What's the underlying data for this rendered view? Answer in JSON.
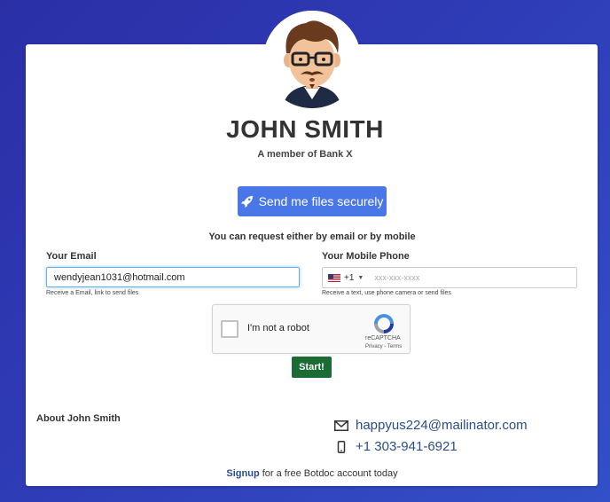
{
  "profile": {
    "name": "JOHN SMITH",
    "subtitle": "A member of Bank X"
  },
  "send_button": {
    "label": "Send me files securely",
    "icon": "rocket-icon"
  },
  "request_note": "You can request either by email or by mobile",
  "email": {
    "label": "Your Email",
    "value": "wendyjean1031@hotmail.com",
    "help": "Receive a Email, link to send files"
  },
  "phone": {
    "label": "Your Mobile Phone",
    "country_code": "+1",
    "placeholder": "xxx-xxx-xxxx",
    "help": "Receive a text, use phone camera or send files"
  },
  "recaptcha": {
    "label": "I'm not a robot",
    "brand": "reCAPTCHA",
    "links": "Privacy - Terms"
  },
  "start_button": {
    "label": "Start!"
  },
  "about": {
    "label": "About John Smith"
  },
  "contact": {
    "email": "happyus224@mailinator.com",
    "phone": "+1 303-941-6921"
  },
  "footer": {
    "signup_link": "Signup",
    "signup_text": " for a free Botdoc account today"
  },
  "colors": {
    "background": "#2f3db8",
    "primary_button": "#4a77e8",
    "start_button": "#1a6b34",
    "link": "#2a4d8a"
  }
}
